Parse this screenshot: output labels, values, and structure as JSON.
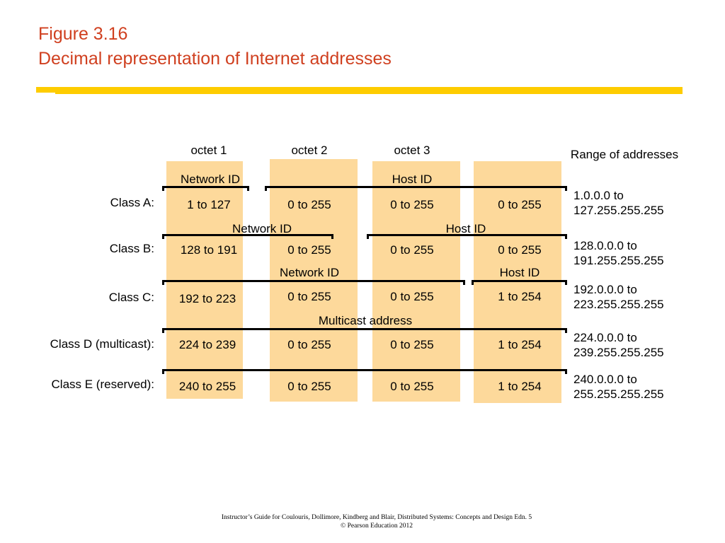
{
  "title": {
    "line1": "Figure 3.16",
    "line2": "Decimal representation of Internet addresses"
  },
  "colors": {
    "title": "#d04020",
    "rule": "#fecc00",
    "octet_box": "#fdd99b"
  },
  "header": {
    "octets": [
      "octet 1",
      "octet 2",
      "octet 3"
    ],
    "range_heading": "Range of addresses"
  },
  "classes": [
    {
      "label": "Class A:",
      "segments": [
        {
          "label": "Network ID"
        },
        {
          "label": "Host ID"
        }
      ],
      "octets": [
        "1 to 127",
        "0 to 255",
        "0 to 255",
        "0 to 255"
      ],
      "range": {
        "from": "1.0.0.0 to",
        "to": "127.255.255.255"
      }
    },
    {
      "label": "Class B:",
      "segments": [
        {
          "label": "Network ID"
        },
        {
          "label": "Host ID"
        }
      ],
      "octets": [
        "128 to 191",
        "0 to 255",
        "0 to 255",
        "0 to 255"
      ],
      "range": {
        "from": "128.0.0.0 to",
        "to": "191.255.255.255"
      }
    },
    {
      "label": "Class C:",
      "segments": [
        {
          "label": "Network ID"
        },
        {
          "label": "Host ID"
        }
      ],
      "octets": [
        "192 to 223",
        "0 to 255",
        "0 to 255",
        "1 to 254"
      ],
      "range": {
        "from": "192.0.0.0 to",
        "to": "223.255.255.255"
      }
    },
    {
      "label": "Class D (multicast):",
      "segments": [
        {
          "label": "Multicast address"
        }
      ],
      "octets": [
        "224 to 239",
        "0 to 255",
        "0 to 255",
        "1 to 254"
      ],
      "range": {
        "from": "224.0.0.0 to",
        "to": "239.255.255.255"
      }
    },
    {
      "label": "Class E (reserved):",
      "segments": [],
      "octets": [
        "240 to 255",
        "0 to 255",
        "0 to 255",
        "1 to 254"
      ],
      "range": {
        "from": "240.0.0.0 to",
        "to": "255.255.255.255"
      }
    }
  ],
  "footer": {
    "line1": "Instructor’s Guide for  Coulouris, Dollimore, Kindberg and Blair,  Distributed Systems: Concepts and Design   Edn. 5",
    "line2": "© Pearson Education 2012"
  }
}
